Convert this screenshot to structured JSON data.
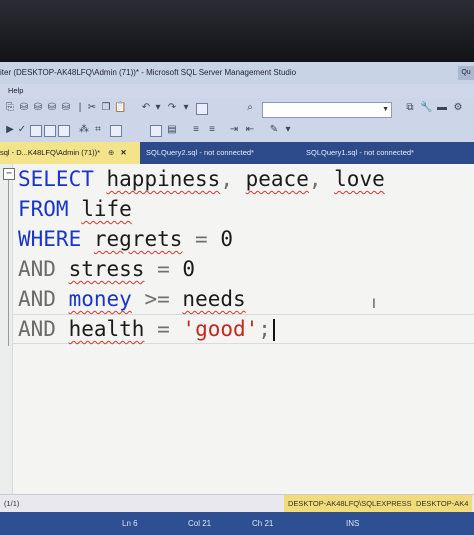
{
  "window": {
    "title": "iter (DESKTOP-AK48LFQ\\Admin (71))* - Microsoft SQL Server Management Studio",
    "title_right": "Qu"
  },
  "menu": {
    "help_label": "Help"
  },
  "toolbar": {
    "separator_glyph": "|"
  },
  "tabs": [
    {
      "label": "sql - D...K48LFQ\\Admin (71))*",
      "pin": "⊕",
      "close": "✕"
    },
    {
      "label": "SQLQuery2.sql - not connected*"
    },
    {
      "label": "SQLQuery1.sql - not connected*"
    }
  ],
  "editor": {
    "collapse_glyph": "−",
    "lines": [
      {
        "kw": "SELECT",
        "rest": [
          "happiness",
          ",",
          "peace",
          ",",
          "love"
        ]
      },
      {
        "kw": "FROM",
        "rest": [
          "life"
        ]
      },
      {
        "kw": "WHERE",
        "rest": [
          "regrets",
          "=",
          "0"
        ]
      },
      {
        "kw": "AND",
        "rest": [
          "stress",
          "=",
          "0"
        ]
      },
      {
        "kw": "AND",
        "rest": [
          "money",
          ">=",
          "needs"
        ]
      },
      {
        "kw": "AND",
        "rest": [
          "health",
          "=",
          "'good'",
          ";"
        ]
      }
    ]
  },
  "status": {
    "lines_info": "(1/1)",
    "server": "DESKTOP-AK48LFQ\\SQLEXPRESS ...",
    "user": "DESKTOP-AK4",
    "ln": "Ln 6",
    "col": "Col 21",
    "ch": "Ch 21",
    "mode": "INS"
  },
  "colors": {
    "keyword": "#1736c8",
    "string": "#c3281b",
    "tab_active": "#f3e38b",
    "tab_bar": "#2d4a8a",
    "status_bar": "#2f4f93"
  }
}
